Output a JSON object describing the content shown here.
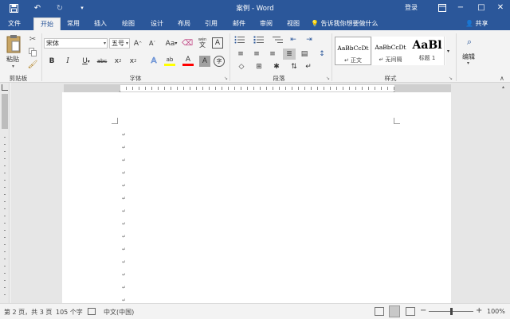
{
  "titlebar": {
    "title": "案例 - Word",
    "login": "登录",
    "qat_dropdown": "▾"
  },
  "tabs": [
    "文件",
    "开始",
    "常用",
    "插入",
    "绘图",
    "设计",
    "布局",
    "引用",
    "邮件",
    "审阅",
    "视图"
  ],
  "tellme": "告诉我你想要做什么",
  "share": "共享",
  "clipboard": {
    "paste": "粘贴",
    "group": "剪贴板"
  },
  "font": {
    "name": "宋体",
    "size": "五号",
    "group": "字体",
    "grow": "A",
    "shrink": "A",
    "case": "Aa",
    "phonetic": "文",
    "border_char": "A",
    "bold": "B",
    "italic": "I",
    "underline": "U",
    "strike": "abc",
    "subscript": "x",
    "superscript": "x",
    "effects": "A",
    "highlight": "ab",
    "color": "A",
    "shading": "A",
    "enclose": "字"
  },
  "paragraph": {
    "group": "段落"
  },
  "styles": {
    "group": "样式",
    "items": [
      {
        "sample": "AaBbCcDt",
        "name": "↵ 正文"
      },
      {
        "sample": "AaBbCcDt",
        "name": "↵ 无间隔"
      },
      {
        "sample": "AaBl",
        "name": "标题 1"
      }
    ]
  },
  "editing": {
    "label": "编辑"
  },
  "status": {
    "page": "第 2 页，共 3 页",
    "words": "105 个字",
    "language": "中文(中国)",
    "zoom": "100%",
    "zoom_minus": "−",
    "zoom_plus": "+",
    "zoom_level": 0.5
  },
  "colors": {
    "accent": "#2b579a",
    "highlight": "#ffff00",
    "font_color": "#ff0000"
  }
}
